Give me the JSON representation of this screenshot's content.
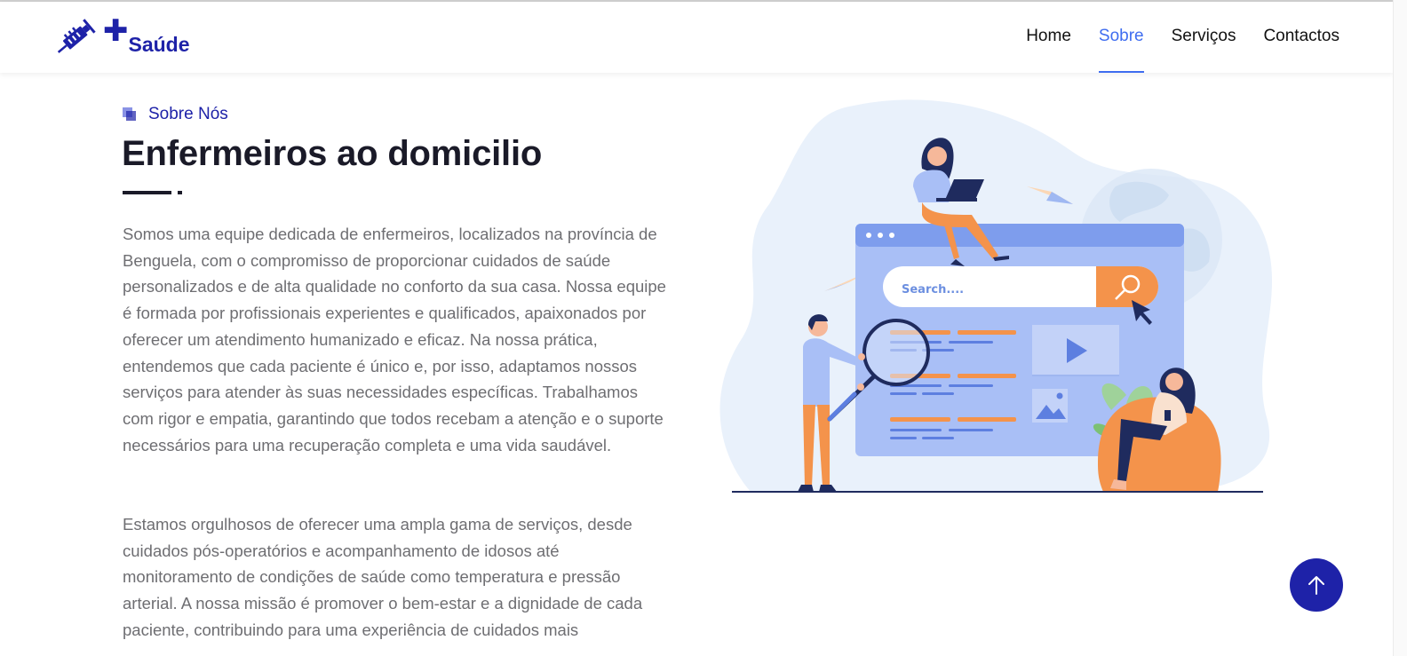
{
  "header": {
    "brand": "Saúde",
    "logo_icon": "syringe-icon",
    "cross_icon": "plus-icon",
    "nav": [
      {
        "label": "Home",
        "active": false
      },
      {
        "label": "Sobre",
        "active": true
      },
      {
        "label": "Serviços",
        "active": false
      },
      {
        "label": "Contactos",
        "active": false
      }
    ]
  },
  "about": {
    "label": "Sobre Nós",
    "title": "Enfermeiros ao domicilio",
    "paragraph1": "Somos uma equipe dedicada de enfermeiros, localizados na província de Benguela, com o compromisso de proporcionar cuidados de saúde personalizados e de alta qualidade no conforto da sua casa. Nossa equipe é formada por profissionais experientes e qualificados, apaixonados por oferecer um atendimento humanizado e eficaz. Na nossa prática, entendemos que cada paciente é único e, por isso, adaptamos nossos serviços para atender às suas necessidades específicas. Trabalhamos com rigor e empatia, garantindo que todos recebam a atenção e o suporte necessários para uma recuperação completa e uma vida saudável.",
    "paragraph2": "Estamos orgulhosos de oferecer uma ampla gama de serviços, desde cuidados pós-operatórios e acompanhamento de idosos até monitoramento de condições de saúde como temperatura e pressão arterial. A nossa missão é promover o bem-estar e a dignidade de cada paciente, contribuindo para uma experiência de cuidados mais"
  },
  "illustration": {
    "search_placeholder": "Search...."
  },
  "colors": {
    "brand": "#1e22a8",
    "accent": "#3f6df0",
    "heading": "#1a1a28",
    "body_text": "#6e6e72"
  },
  "back_to_top_icon": "arrow-up-icon"
}
